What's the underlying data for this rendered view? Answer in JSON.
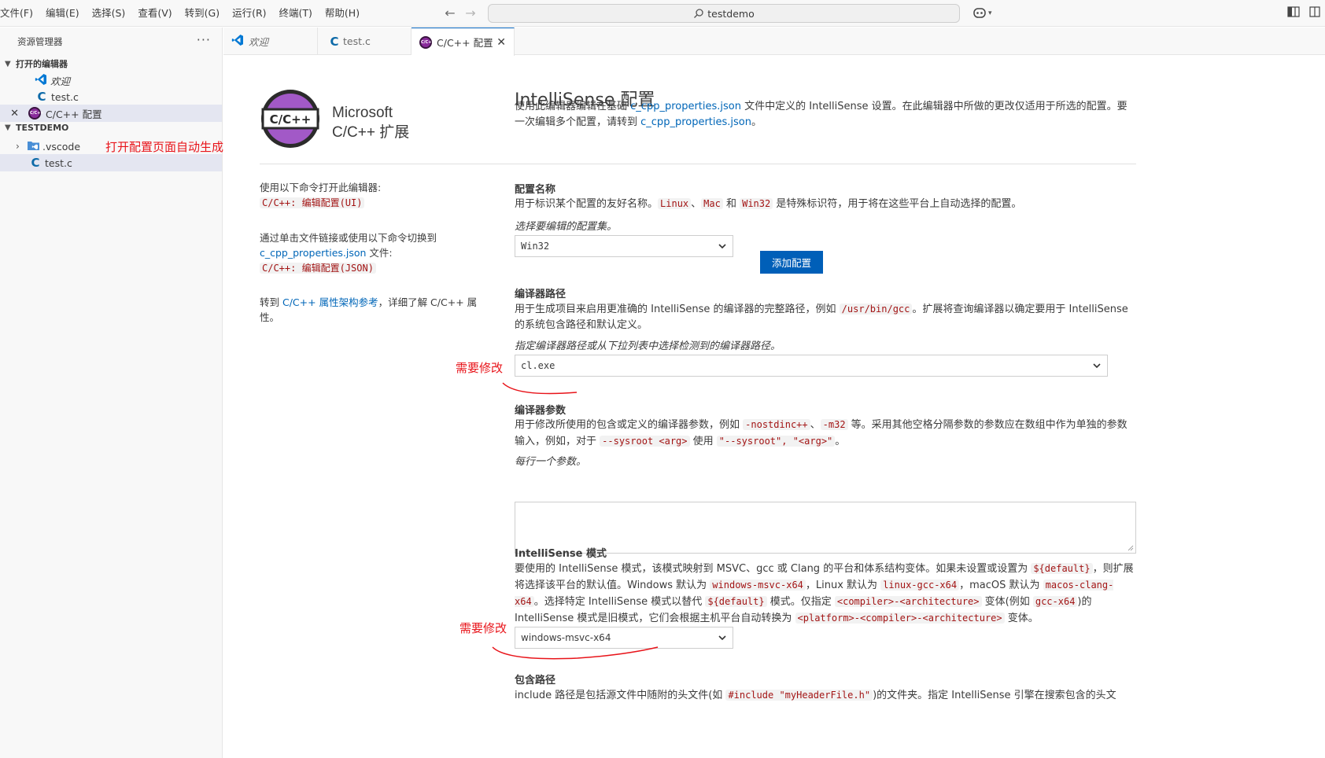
{
  "menubar": [
    "文件(F)",
    "编辑(E)",
    "选择(S)",
    "查看(V)",
    "转到(G)",
    "运行(R)",
    "终端(T)",
    "帮助(H)"
  ],
  "command_center": {
    "text": "testdemo",
    "icon": "search-icon"
  },
  "sidebar": {
    "title": "资源管理器",
    "open_editors": {
      "title": "打开的编辑器",
      "items": [
        {
          "label": "欢迎",
          "icon": "vscode-logo-icon"
        },
        {
          "label": "test.c",
          "icon": "c-file-icon"
        },
        {
          "label": "C/C++ 配置",
          "icon": "cpp-extension-icon"
        }
      ]
    },
    "workspace": {
      "title": "TESTDEMO",
      "items": [
        {
          "label": ".vscode",
          "icon": "vscode-folder-icon"
        },
        {
          "label": "test.c",
          "icon": "c-file-icon"
        }
      ]
    },
    "annotation": "打开配置页面自动生成此目录"
  },
  "tabs": [
    {
      "label": "欢迎",
      "icon": "vscode-logo-icon"
    },
    {
      "label": "test.c",
      "icon": "c-file-icon"
    },
    {
      "label": "C/C++ 配置",
      "icon": "cpp-extension-icon",
      "active": true
    }
  ],
  "extension": {
    "logo_text": "C/C++",
    "line1": "Microsoft",
    "line2": "C/C++ 扩展"
  },
  "left_panel": {
    "open_ui_text": "使用以下命令打开此编辑器:",
    "open_ui_cmd": "C/C++: 编辑配置(UI)",
    "switch_pre": "通过单击文件链接或使用以下命令切换到",
    "switch_link": "c_cpp_properties.json",
    "switch_post": " 文件:",
    "switch_cmd": "C/C++: 编辑配置(JSON)",
    "ref_pre": "转到 ",
    "ref_link": "C/C++ 属性架构参考",
    "ref_post": "，详细了解 C/C++ 属性。"
  },
  "main": {
    "title": "IntelliSense 配置",
    "intro_pre": "使用此编辑器编辑在基础 ",
    "intro_link1": "c_cpp_properties.json",
    "intro_mid": " 文件中定义的 IntelliSense 设置。在此编辑器中所做的更改仅适用于所选的配置。要一次编辑多个配置，请转到 ",
    "intro_link2": "c_cpp_properties.json",
    "intro_post": "。",
    "config_name": {
      "title": "配置名称",
      "desc_pre": "用于标识某个配置的友好名称。",
      "code1": "Linux",
      "sep1": "、",
      "code2": "Mac",
      "sep2": " 和 ",
      "code3": "Win32",
      "desc_post": " 是特殊标识符，用于将在这些平台上自动选择的配置。",
      "hint": "选择要编辑的配置集。",
      "selected": "Win32",
      "add_button": "添加配置"
    },
    "compiler_path": {
      "title": "编译器路径",
      "desc_pre": "用于生成项目来启用更准确的 IntelliSense 的编译器的完整路径，例如 ",
      "code1": "/usr/bin/gcc",
      "desc_post": "。扩展将查询编译器以确定要用于 IntelliSense 的系统包含路径和默认定义。",
      "hint": "指定编译器路径或从下拉列表中选择检测到的编译器路径。",
      "value": "cl.exe",
      "annotation": "需要修改"
    },
    "compiler_args": {
      "title": "编译器参数",
      "desc_pre": "用于修改所使用的包含或定义的编译器参数，例如 ",
      "code1": "-nostdinc++",
      "sep1": "、",
      "code2": "-m32",
      "desc_mid": " 等。采用其他空格分隔参数的参数应在数组中作为单独的参数输入，例如，对于 ",
      "code3": "--sysroot <arg>",
      "desc_mid2": " 使用 ",
      "code4": "\"--sysroot\", \"<arg>\"",
      "desc_post": "。",
      "hint": "每行一个参数。",
      "value": ""
    },
    "intellisense_mode": {
      "title": "IntelliSense 模式",
      "d1": "要使用的 IntelliSense 模式，该模式映射到 MSVC、gcc 或 Clang 的平台和体系结构变体。如果未设置或设置为 ",
      "c1": "${default}",
      "d2": "，则扩展将选择该平台的默认值。Windows 默认为 ",
      "c2": "windows-msvc-x64",
      "d3": "，Linux 默认为 ",
      "c3": "linux-gcc-x64",
      "d4": "，macOS 默认为 ",
      "c4": "macos-clang-x64",
      "d5": "。选择特定 IntelliSense 模式以替代 ",
      "c5": "${default}",
      "d6": " 模式。仅指定 ",
      "c6": "<compiler>-<architecture>",
      "d7": " 变体(例如 ",
      "c7": "gcc-x64",
      "d8": ")的 IntelliSense 模式是旧模式，它们会根据主机平台自动转换为 ",
      "c8": "<platform>-<compiler>-<architecture>",
      "d9": " 变体。",
      "selected": "windows-msvc-x64",
      "annotation": "需要修改"
    },
    "include_path": {
      "title": "包含路径",
      "d1": "include 路径是包括源文件中随附的头文件(如 ",
      "c1": "#include \"myHeaderFile.h\"",
      "d2": ")的文件夹。指定 IntelliSense 引擎在搜索包含的头文"
    }
  },
  "colors": {
    "accent": "#005fb8",
    "annotation": "#e8141a",
    "code_text": "#a31515",
    "link": "#0066b8"
  }
}
